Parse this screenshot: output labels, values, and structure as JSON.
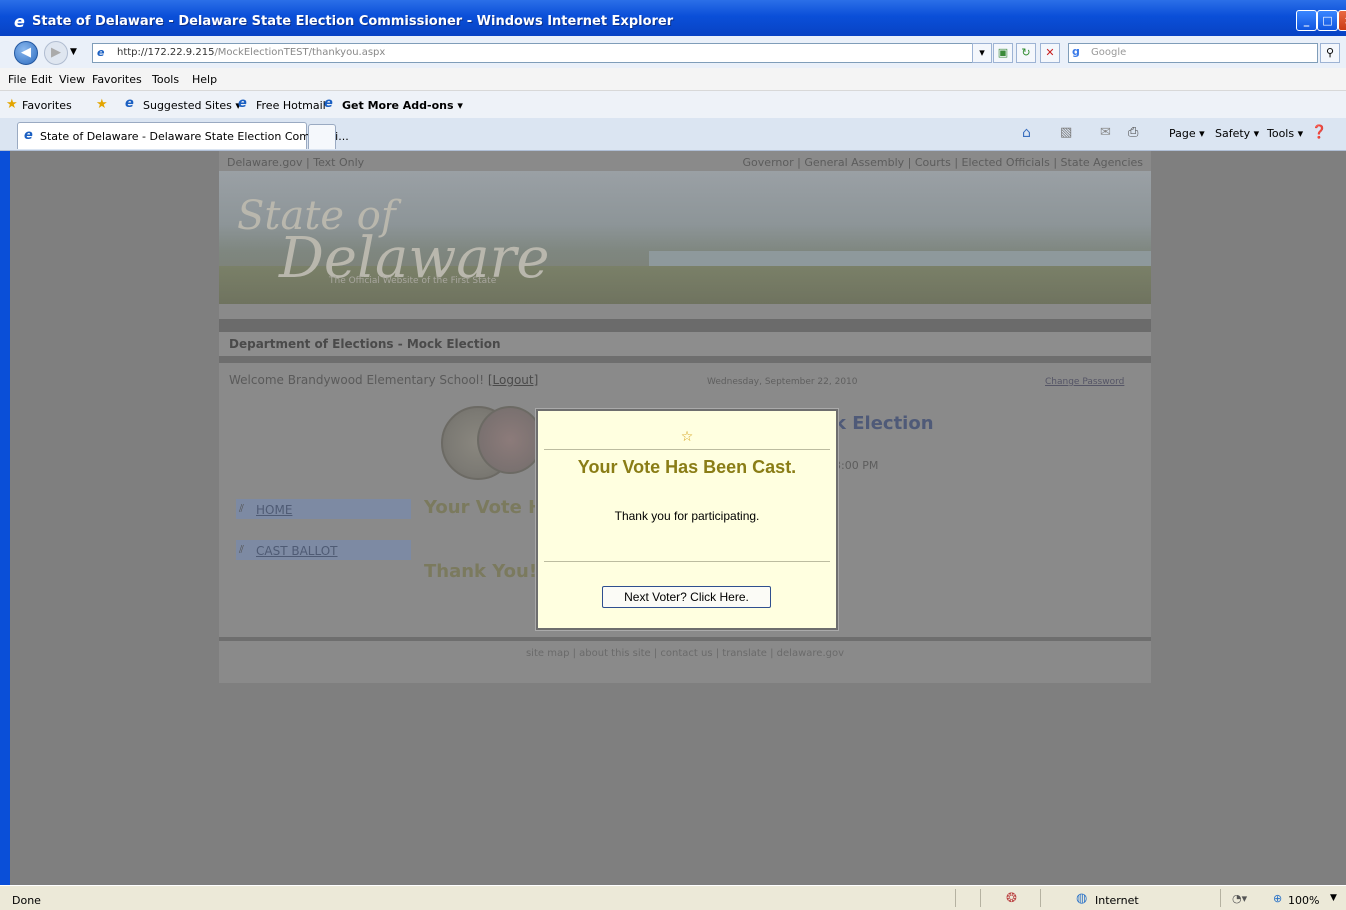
{
  "window": {
    "title": "State of Delaware - Delaware State Election Commissioner - Windows Internet Explorer"
  },
  "address": {
    "url_host": "http://172.22.9.215",
    "url_path": "/MockElectionTEST/thankyou.aspx",
    "search_placeholder": "Google"
  },
  "menu": [
    "File",
    "Edit",
    "View",
    "Favorites",
    "Tools",
    "Help"
  ],
  "favorites_bar": {
    "favorites": "Favorites",
    "suggested": "Suggested Sites ▾",
    "hotmail": "Free Hotmail",
    "addons": "Get More Add-ons ▾"
  },
  "tab": {
    "title": "State of Delaware - Delaware State Election Commissi..."
  },
  "commandbar": {
    "page": "Page ▾",
    "safety": "Safety ▾",
    "tools": "Tools ▾"
  },
  "site": {
    "toplinks_left": "Delaware.gov  |  Text Only",
    "toplinks_right": "Governor | General Assembly | Courts | Elected Officials | State Agencies",
    "logo_line1": "State of",
    "logo_line2": "Delaware",
    "logo_tagline": "The Official Website of the First State",
    "dept_title": "Department of Elections - Mock Election",
    "welcome": "Welcome Brandywood Elementary School!",
    "logout": "[Logout]",
    "date": "Wednesday, September 22, 2010",
    "change_password": "Change Password",
    "nav_home": "HOME",
    "nav_cast": "CAST BALLOT",
    "bg_vote": "Your Vote H",
    "bg_thanks": "Thank You!",
    "bg_election": "k Election",
    "bg_time": "3:00 PM",
    "footer": "site map  |  about this site  |  contact us  |  translate  |  delaware.gov"
  },
  "modal": {
    "heading": "Your Vote Has Been Cast.",
    "message": "Thank you for participating.",
    "button": "Next Voter? Click Here."
  },
  "status": {
    "left": "Done",
    "zone": "Internet",
    "zoom": "100%"
  }
}
